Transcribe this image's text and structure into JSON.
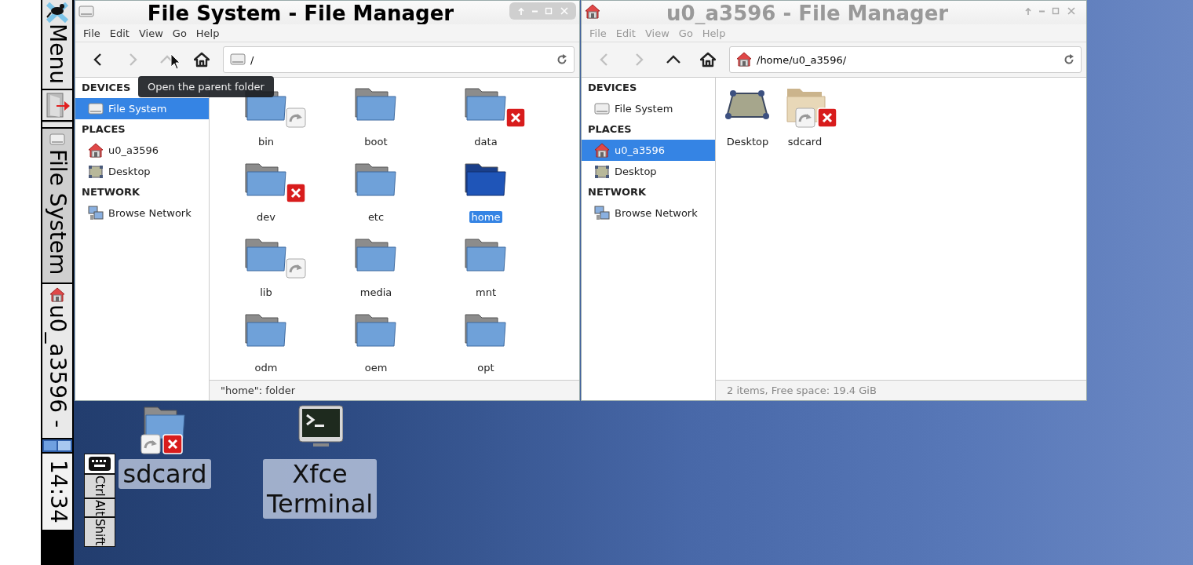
{
  "panel": {
    "menu_label": "Menu",
    "tasks": [
      {
        "label": "File System",
        "kind": "drive",
        "selected": true
      },
      {
        "label": "u0_a3596 - ",
        "kind": "home",
        "selected": false
      }
    ],
    "clock": "14:34"
  },
  "windows": [
    {
      "title": "File System - File Manager",
      "focused": true,
      "menu": [
        "File",
        "Edit",
        "View",
        "Go",
        "Help"
      ],
      "toolbar": [
        {
          "kind": "back",
          "disabled": false
        },
        {
          "kind": "forward",
          "disabled": true
        },
        {
          "kind": "up",
          "disabled": true
        },
        {
          "kind": "home",
          "disabled": false
        }
      ],
      "location": {
        "kind": "drive",
        "text": "/"
      },
      "sidebar": [
        {
          "heading": "DEVICES",
          "items": [
            {
              "label": "File System",
              "kind": "drive",
              "selected": true
            }
          ]
        },
        {
          "heading": "PLACES",
          "items": [
            {
              "label": "u0_a3596",
              "kind": "home",
              "selected": false
            },
            {
              "label": "Desktop",
              "kind": "desktop",
              "selected": false
            }
          ]
        },
        {
          "heading": "NETWORK",
          "items": [
            {
              "label": "Browse Network",
              "kind": "network",
              "selected": false
            }
          ]
        }
      ],
      "files": [
        {
          "name": "bin",
          "kind": "folder",
          "link": true,
          "locked": false,
          "selected": false
        },
        {
          "name": "boot",
          "kind": "folder",
          "link": false,
          "locked": false,
          "selected": false
        },
        {
          "name": "data",
          "kind": "folder",
          "link": false,
          "locked": true,
          "selected": false
        },
        {
          "name": "dev",
          "kind": "folder",
          "link": false,
          "locked": true,
          "selected": false
        },
        {
          "name": "etc",
          "kind": "folder",
          "link": false,
          "locked": false,
          "selected": false
        },
        {
          "name": "home",
          "kind": "folder",
          "link": false,
          "locked": false,
          "selected": true
        },
        {
          "name": "lib",
          "kind": "folder",
          "link": true,
          "locked": false,
          "selected": false
        },
        {
          "name": "media",
          "kind": "folder",
          "link": false,
          "locked": false,
          "selected": false
        },
        {
          "name": "mnt",
          "kind": "folder",
          "link": false,
          "locked": false,
          "selected": false
        },
        {
          "name": "odm",
          "kind": "folder",
          "link": false,
          "locked": false,
          "selected": false
        },
        {
          "name": "oem",
          "kind": "folder",
          "link": false,
          "locked": false,
          "selected": false
        },
        {
          "name": "opt",
          "kind": "folder",
          "link": false,
          "locked": false,
          "selected": false
        }
      ],
      "status": "\"home\": folder",
      "tooltip": "Open the parent folder"
    },
    {
      "title": "u0_a3596 - File Manager",
      "focused": false,
      "menu": [
        "File",
        "Edit",
        "View",
        "Go",
        "Help"
      ],
      "toolbar": [
        {
          "kind": "back",
          "disabled": true
        },
        {
          "kind": "forward",
          "disabled": true
        },
        {
          "kind": "up",
          "disabled": false
        },
        {
          "kind": "home",
          "disabled": false
        }
      ],
      "location": {
        "kind": "home",
        "text": "/home/u0_a3596/"
      },
      "sidebar": [
        {
          "heading": "DEVICES",
          "items": [
            {
              "label": "File System",
              "kind": "drive",
              "selected": false
            }
          ]
        },
        {
          "heading": "PLACES",
          "items": [
            {
              "label": "u0_a3596",
              "kind": "home",
              "selected": true
            },
            {
              "label": "Desktop",
              "kind": "desktop",
              "selected": false
            }
          ]
        },
        {
          "heading": "NETWORK",
          "items": [
            {
              "label": "Browse Network",
              "kind": "network",
              "selected": false
            }
          ]
        }
      ],
      "files": [
        {
          "name": "Desktop",
          "kind": "desktop",
          "link": false,
          "locked": false,
          "selected": false
        },
        {
          "name": "sdcard",
          "kind": "shared-folder",
          "link": true,
          "locked": true,
          "selected": false
        }
      ],
      "status": "2 items, Free space: 19.4 GiB"
    }
  ],
  "desktop_icons": [
    {
      "label": "sdcard",
      "kind": "folder",
      "link": true,
      "locked": true
    },
    {
      "label": "Xfce Terminal",
      "kind": "terminal",
      "link": false,
      "locked": false
    }
  ],
  "keyboard": {
    "keys": [
      "Ctrl",
      "Alt",
      "Shift"
    ]
  }
}
